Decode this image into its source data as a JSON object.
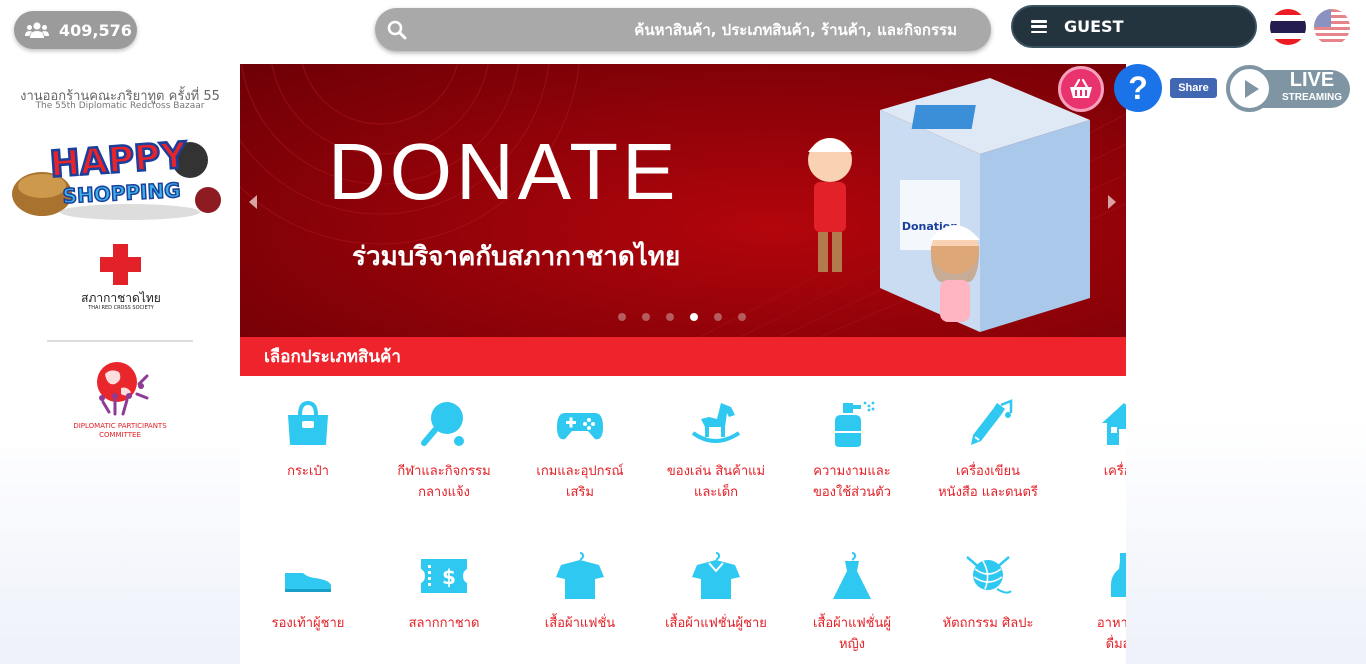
{
  "header": {
    "visitor_count": "409,576",
    "search_placeholder": "ค้นหาสินค้า, ประเภทสินค้า, ร้านค้า, และกิจกรรม",
    "user_label": "GUEST"
  },
  "sidebar": {
    "bazaar_title_th": "งานออกร้านคณะภริยาทูต ครั้งที่ 55",
    "bazaar_title_en": "The 55th Diplomatic Redcross Bazaar",
    "happy_logo_text": "HAPPY SHOPPING",
    "redcross_name_th": "สภากาชาดไทย",
    "redcross_name_en": "THAI RED CROSS SOCIETY",
    "dpc_name": "DIPLOMATIC PARTICIPANTS COMMITTEE"
  },
  "banner": {
    "title": "DONATE",
    "subtitle": "ร่วมบริจาคกับสภากาชาดไทย",
    "box_text": "Donation",
    "slide_count": 6,
    "active_slide": 4
  },
  "floating": {
    "help_label": "?",
    "share_label": "Share",
    "live_label": "LIVE",
    "live_sub": "STREAMING"
  },
  "categories": {
    "header": "เลือกประเภทสินค้า",
    "row1": [
      {
        "line1": "กระเป๋า",
        "line2": "",
        "icon": "bag-icon"
      },
      {
        "line1": "กีฬาและกิจกรรม",
        "line2": "กลางแจ้ง",
        "icon": "pingpong-icon"
      },
      {
        "line1": "เกมและอุปกรณ์",
        "line2": "เสริม",
        "icon": "gamepad-icon"
      },
      {
        "line1": "ของเล่น สินค้าแม่",
        "line2": "และเด็ก",
        "icon": "rocking-horse-icon"
      },
      {
        "line1": "ความงามและ",
        "line2": "ของใช้ส่วนตัว",
        "icon": "spray-bottle-icon"
      },
      {
        "line1": "เครื่องเขียน",
        "line2": "หนังสือ และดนตรี",
        "icon": "pen-note-icon"
      },
      {
        "line1": "เครื่องใ",
        "line2": "",
        "icon": "house-icon"
      }
    ],
    "row2": [
      {
        "line1": "รองเท้าผู้ชาย",
        "line2": "",
        "icon": "shoe-icon"
      },
      {
        "line1": "สลากกาชาด",
        "line2": "",
        "icon": "ticket-icon"
      },
      {
        "line1": "เสื้อผ้าแฟชั่น",
        "line2": "",
        "icon": "shirt-icon"
      },
      {
        "line1": "เสื้อผ้าแฟชั่นผู้ชาย",
        "line2": "",
        "icon": "mens-shirt-icon"
      },
      {
        "line1": "เสื้อผ้าแฟชั่นผู้",
        "line2": "หญิง",
        "icon": "dress-icon"
      },
      {
        "line1": "หัตถกรรม ศิลปะ",
        "line2": "",
        "icon": "yarn-icon"
      },
      {
        "line1": "อาหารแล",
        "line2": "ดื่มสำเ",
        "icon": "bottle-icon"
      }
    ]
  },
  "colors": {
    "accent_red": "#ee232b",
    "icon_cyan": "#2ec8f0",
    "guest_bg": "#23343e",
    "banner_red": "#8c0208"
  }
}
